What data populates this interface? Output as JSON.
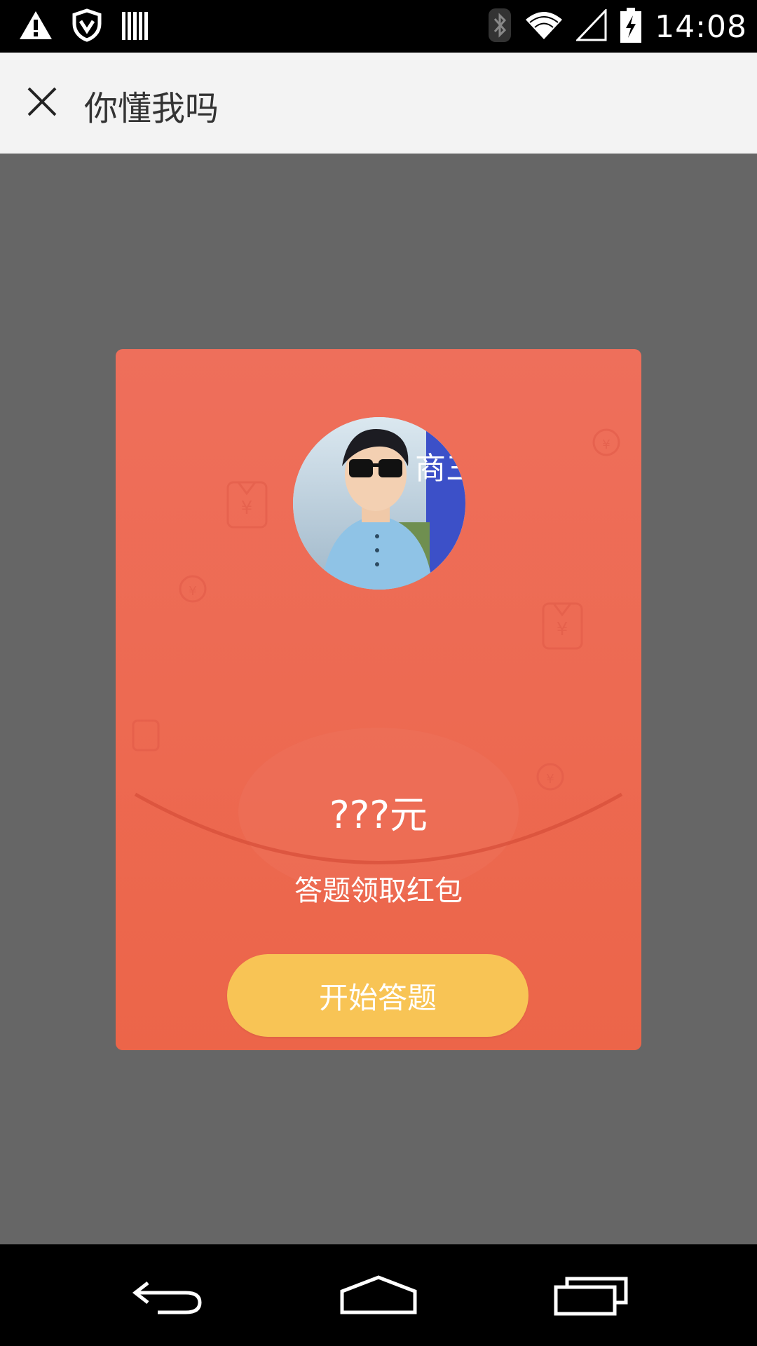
{
  "status_bar": {
    "time": "14:08",
    "left_icons": [
      "warning-icon",
      "shield-icon",
      "barcode-icon"
    ],
    "right_icons": [
      "bluetooth-icon",
      "wifi-icon",
      "cell-signal-icon",
      "battery-charging-icon"
    ]
  },
  "toolbar": {
    "close_icon": "close-icon",
    "title": "你懂我吗"
  },
  "card": {
    "avatar_sign_text": "商三",
    "amount": "???元",
    "subtitle": "答题领取红包",
    "start_button_label": "开始答题",
    "colors": {
      "card_top": "#ee6f5b",
      "card_bottom": "#ec6549",
      "button": "#f8c455"
    }
  },
  "nav_bar": {
    "icons": [
      "back-icon",
      "home-icon",
      "recents-icon"
    ]
  }
}
